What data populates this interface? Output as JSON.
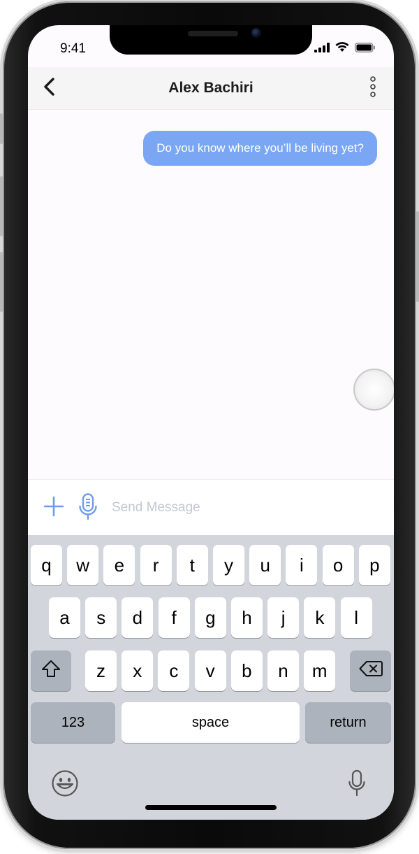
{
  "status_bar": {
    "time": "9:41"
  },
  "conversation": {
    "title": "Alex Bachiri"
  },
  "messages": [
    {
      "text": "Do you know where you’ll be living yet?",
      "sender": "me"
    }
  ],
  "composer": {
    "placeholder": "Send Message"
  },
  "keyboard": {
    "row1": [
      "q",
      "w",
      "e",
      "r",
      "t",
      "y",
      "u",
      "i",
      "o",
      "p"
    ],
    "row2": [
      "a",
      "s",
      "d",
      "f",
      "g",
      "h",
      "j",
      "k",
      "l"
    ],
    "row3": [
      "z",
      "x",
      "c",
      "v",
      "b",
      "n",
      "m"
    ],
    "numbers_label": "123",
    "space_label": "space",
    "return_label": "return"
  },
  "colors": {
    "bubble": "#7aa6f3",
    "accent_icon": "#6f9de8",
    "keyboard_bg": "#d2d5db"
  },
  "icons": {
    "back": "chevron-left-icon",
    "more": "vertical-ellipsis-icon",
    "add": "plus-icon",
    "voice": "microphone-icon",
    "shift": "shift-icon",
    "delete": "backspace-icon",
    "emoji": "emoji-icon",
    "dictation": "microphone-icon"
  }
}
